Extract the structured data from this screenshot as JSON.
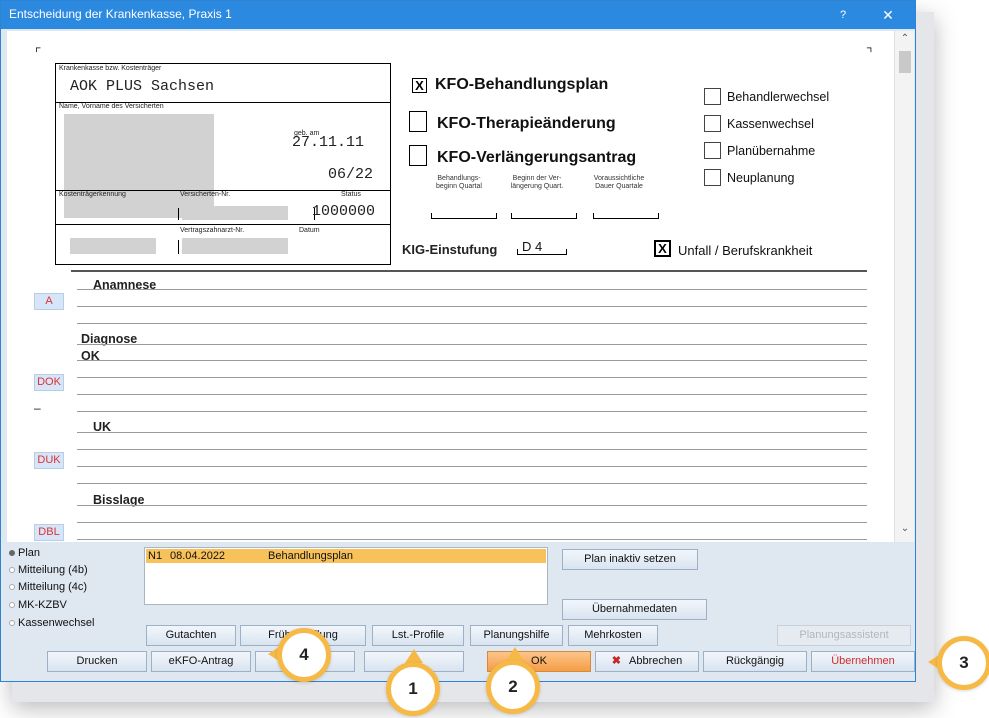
{
  "window": {
    "title": "Entscheidung der Krankenkasse, Praxis 1",
    "help_label": "?",
    "close_label": "✕"
  },
  "form": {
    "payer_label": "Krankenkasse bzw. Kostenträger",
    "payer_value": "AOK PLUS Sachsen",
    "name_label": "Name, Vorname des Versicherten",
    "birth_label": "geb. am",
    "birth_value": "27.11.11",
    "expiry_value": "06/22",
    "payer_id_label": "Kostenträgerkennung",
    "insured_no_label": "Versicherten-Nr.",
    "status_label": "Status",
    "status_value": "1000000",
    "dentist_no_label": "Vertragszahnarzt-Nr.",
    "date_label": "Datum",
    "options": {
      "behandlungsplan": {
        "label": "KFO-Behandlungsplan",
        "mark": "X"
      },
      "therapieaenderung": {
        "label": "KFO-Therapieänderung",
        "mark": ""
      },
      "verlaengerung": {
        "label": "KFO-Verlängerungsantrag",
        "mark": ""
      }
    },
    "quarter_labels": [
      "Behandlungs-\nbeginn Quartal",
      "Beginn der Ver-\nlängerung Quart.",
      "Voraussichtliche\nDauer Quartale"
    ],
    "right_checks": [
      "Behandlerwechsel",
      "Kassenwechsel",
      "Planübernahme",
      "Neuplanung"
    ],
    "kig_label": "KIG-Einstufung",
    "kig_value": "D 4",
    "accident_mark": "X",
    "accident_label": "Unfall / Berufskrankheit",
    "sections": {
      "anamnese": "Anamnese",
      "diagnose": "Diagnose",
      "ok": "OK",
      "uk": "UK",
      "bisslage": "Bisslage",
      "dash": "–"
    },
    "side_buttons": {
      "a": "A",
      "dok": "DOK",
      "duk": "DUK",
      "dbl": "DBL"
    }
  },
  "scrollbar": {
    "up": "⌃",
    "down": "⌄"
  },
  "bottom": {
    "radios": [
      {
        "label": "Plan",
        "selected": true
      },
      {
        "label": "Mitteilung (4b)",
        "selected": false
      },
      {
        "label": "Mitteilung (4c)",
        "selected": false
      },
      {
        "label": "MK-KZBV",
        "selected": false
      },
      {
        "label": "Kassenwechsel",
        "selected": false
      }
    ],
    "plan_row": {
      "id": "N1",
      "date": "08.04.2022",
      "type": "Behandlungsplan"
    },
    "buttons": {
      "plan_inaktiv": "Plan inaktiv setzen",
      "uebernahmedaten": "Übernahmedaten",
      "gutachten": "Gutachten",
      "fruehmitteilung": "Frühmitteilung",
      "lst_profile": "Lst.-Profile",
      "planungshilfe": "Planungshilfe",
      "mehrkosten": "Mehrkosten",
      "planungsassistent": "Planungsassistent",
      "drucken": "Drucken",
      "ekfo": "eKFO-Antrag",
      "ok": "OK",
      "abbrechen": "Abbrechen",
      "rueckgaengig": "Rückgängig",
      "uebernehmen": "Übernehmen"
    }
  },
  "callouts": [
    "1",
    "2",
    "3",
    "4"
  ],
  "colors": {
    "titlebar": "#2c89e0",
    "callout_ring": "#f6b946",
    "selected_row": "#f7c25a",
    "danger": "#d22a2a"
  }
}
